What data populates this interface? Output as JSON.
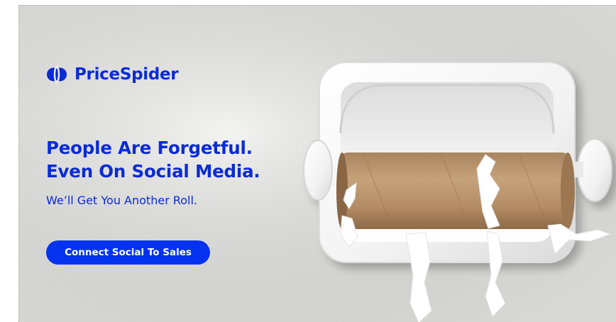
{
  "brand": {
    "name": "PriceSpider",
    "color": "#0a2bd6"
  },
  "ad": {
    "headline_line1": "People Are Forgetful.",
    "headline_line2": "Even On Social Media.",
    "subhead": "We’ll Get You Another Roll.",
    "cta_label": "Connect Social To Sales",
    "cta_color": "#0433f0"
  },
  "image": {
    "subject": "empty-toilet-paper-roll-icon"
  }
}
